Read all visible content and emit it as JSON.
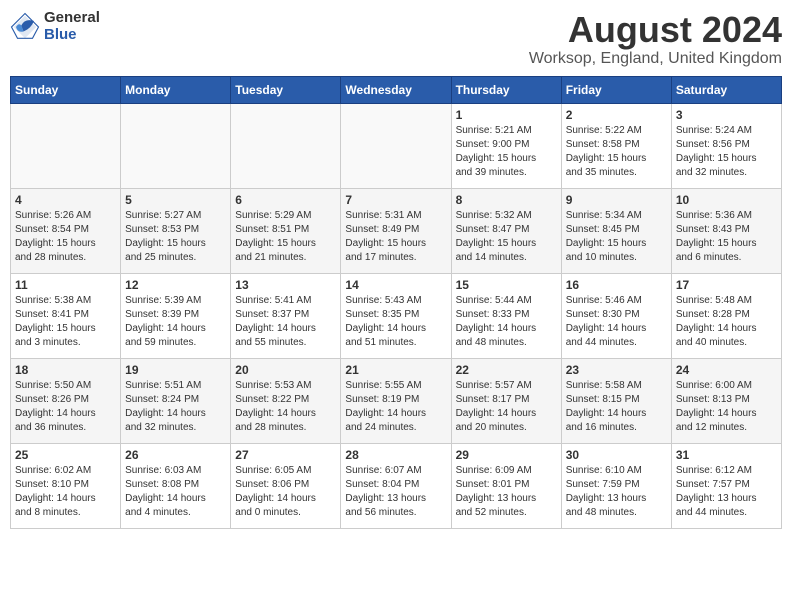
{
  "header": {
    "logo_general": "General",
    "logo_blue": "Blue",
    "main_title": "August 2024",
    "subtitle": "Worksop, England, United Kingdom"
  },
  "days_of_week": [
    "Sunday",
    "Monday",
    "Tuesday",
    "Wednesday",
    "Thursday",
    "Friday",
    "Saturday"
  ],
  "weeks": [
    {
      "row_class": "week-row-odd",
      "days": [
        {
          "num": "",
          "data": "",
          "empty": true
        },
        {
          "num": "",
          "data": "",
          "empty": true
        },
        {
          "num": "",
          "data": "",
          "empty": true
        },
        {
          "num": "",
          "data": "",
          "empty": true
        },
        {
          "num": "1",
          "data": "Sunrise: 5:21 AM\nSunset: 9:00 PM\nDaylight: 15 hours\nand 39 minutes.",
          "empty": false
        },
        {
          "num": "2",
          "data": "Sunrise: 5:22 AM\nSunset: 8:58 PM\nDaylight: 15 hours\nand 35 minutes.",
          "empty": false
        },
        {
          "num": "3",
          "data": "Sunrise: 5:24 AM\nSunset: 8:56 PM\nDaylight: 15 hours\nand 32 minutes.",
          "empty": false
        }
      ]
    },
    {
      "row_class": "week-row-even",
      "days": [
        {
          "num": "4",
          "data": "Sunrise: 5:26 AM\nSunset: 8:54 PM\nDaylight: 15 hours\nand 28 minutes.",
          "empty": false
        },
        {
          "num": "5",
          "data": "Sunrise: 5:27 AM\nSunset: 8:53 PM\nDaylight: 15 hours\nand 25 minutes.",
          "empty": false
        },
        {
          "num": "6",
          "data": "Sunrise: 5:29 AM\nSunset: 8:51 PM\nDaylight: 15 hours\nand 21 minutes.",
          "empty": false
        },
        {
          "num": "7",
          "data": "Sunrise: 5:31 AM\nSunset: 8:49 PM\nDaylight: 15 hours\nand 17 minutes.",
          "empty": false
        },
        {
          "num": "8",
          "data": "Sunrise: 5:32 AM\nSunset: 8:47 PM\nDaylight: 15 hours\nand 14 minutes.",
          "empty": false
        },
        {
          "num": "9",
          "data": "Sunrise: 5:34 AM\nSunset: 8:45 PM\nDaylight: 15 hours\nand 10 minutes.",
          "empty": false
        },
        {
          "num": "10",
          "data": "Sunrise: 5:36 AM\nSunset: 8:43 PM\nDaylight: 15 hours\nand 6 minutes.",
          "empty": false
        }
      ]
    },
    {
      "row_class": "week-row-odd",
      "days": [
        {
          "num": "11",
          "data": "Sunrise: 5:38 AM\nSunset: 8:41 PM\nDaylight: 15 hours\nand 3 minutes.",
          "empty": false
        },
        {
          "num": "12",
          "data": "Sunrise: 5:39 AM\nSunset: 8:39 PM\nDaylight: 14 hours\nand 59 minutes.",
          "empty": false
        },
        {
          "num": "13",
          "data": "Sunrise: 5:41 AM\nSunset: 8:37 PM\nDaylight: 14 hours\nand 55 minutes.",
          "empty": false
        },
        {
          "num": "14",
          "data": "Sunrise: 5:43 AM\nSunset: 8:35 PM\nDaylight: 14 hours\nand 51 minutes.",
          "empty": false
        },
        {
          "num": "15",
          "data": "Sunrise: 5:44 AM\nSunset: 8:33 PM\nDaylight: 14 hours\nand 48 minutes.",
          "empty": false
        },
        {
          "num": "16",
          "data": "Sunrise: 5:46 AM\nSunset: 8:30 PM\nDaylight: 14 hours\nand 44 minutes.",
          "empty": false
        },
        {
          "num": "17",
          "data": "Sunrise: 5:48 AM\nSunset: 8:28 PM\nDaylight: 14 hours\nand 40 minutes.",
          "empty": false
        }
      ]
    },
    {
      "row_class": "week-row-even",
      "days": [
        {
          "num": "18",
          "data": "Sunrise: 5:50 AM\nSunset: 8:26 PM\nDaylight: 14 hours\nand 36 minutes.",
          "empty": false
        },
        {
          "num": "19",
          "data": "Sunrise: 5:51 AM\nSunset: 8:24 PM\nDaylight: 14 hours\nand 32 minutes.",
          "empty": false
        },
        {
          "num": "20",
          "data": "Sunrise: 5:53 AM\nSunset: 8:22 PM\nDaylight: 14 hours\nand 28 minutes.",
          "empty": false
        },
        {
          "num": "21",
          "data": "Sunrise: 5:55 AM\nSunset: 8:19 PM\nDaylight: 14 hours\nand 24 minutes.",
          "empty": false
        },
        {
          "num": "22",
          "data": "Sunrise: 5:57 AM\nSunset: 8:17 PM\nDaylight: 14 hours\nand 20 minutes.",
          "empty": false
        },
        {
          "num": "23",
          "data": "Sunrise: 5:58 AM\nSunset: 8:15 PM\nDaylight: 14 hours\nand 16 minutes.",
          "empty": false
        },
        {
          "num": "24",
          "data": "Sunrise: 6:00 AM\nSunset: 8:13 PM\nDaylight: 14 hours\nand 12 minutes.",
          "empty": false
        }
      ]
    },
    {
      "row_class": "week-row-odd",
      "days": [
        {
          "num": "25",
          "data": "Sunrise: 6:02 AM\nSunset: 8:10 PM\nDaylight: 14 hours\nand 8 minutes.",
          "empty": false
        },
        {
          "num": "26",
          "data": "Sunrise: 6:03 AM\nSunset: 8:08 PM\nDaylight: 14 hours\nand 4 minutes.",
          "empty": false
        },
        {
          "num": "27",
          "data": "Sunrise: 6:05 AM\nSunset: 8:06 PM\nDaylight: 14 hours\nand 0 minutes.",
          "empty": false
        },
        {
          "num": "28",
          "data": "Sunrise: 6:07 AM\nSunset: 8:04 PM\nDaylight: 13 hours\nand 56 minutes.",
          "empty": false
        },
        {
          "num": "29",
          "data": "Sunrise: 6:09 AM\nSunset: 8:01 PM\nDaylight: 13 hours\nand 52 minutes.",
          "empty": false
        },
        {
          "num": "30",
          "data": "Sunrise: 6:10 AM\nSunset: 7:59 PM\nDaylight: 13 hours\nand 48 minutes.",
          "empty": false
        },
        {
          "num": "31",
          "data": "Sunrise: 6:12 AM\nSunset: 7:57 PM\nDaylight: 13 hours\nand 44 minutes.",
          "empty": false
        }
      ]
    }
  ]
}
